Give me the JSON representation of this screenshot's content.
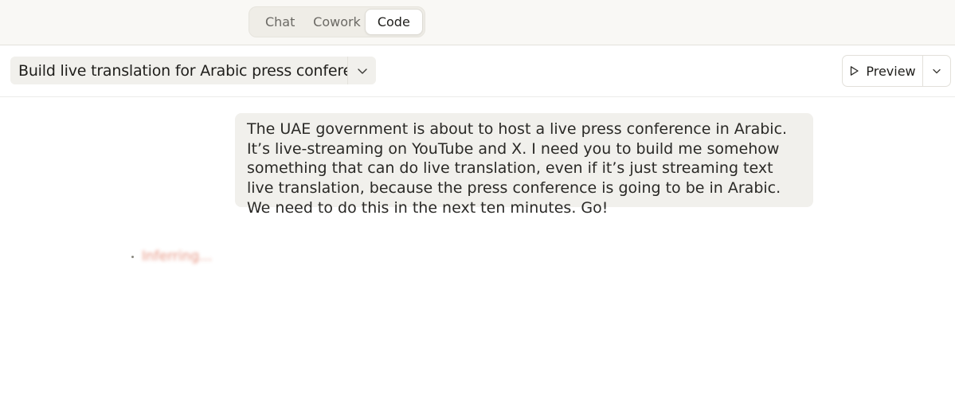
{
  "mode_switch": {
    "tabs": [
      {
        "label": "Chat",
        "selected": false
      },
      {
        "label": "Cowork",
        "selected": false
      },
      {
        "label": "Code",
        "selected": true
      }
    ]
  },
  "header": {
    "session_title": "Build live translation for Arabic press conference",
    "preview_label": "Preview"
  },
  "conversation": {
    "user_message": "The UAE government is about to host a live press conference in Arabic. It’s live-streaming on YouTube and X. I need you to build me somehow something that can do live translation, even if it’s just streaming text live translation, because the press conference is going to be in Arabic. We need to do this in the next ten minutes. Go!",
    "status_text": "Inferring..."
  },
  "colors": {
    "status_accent": "#e07a63",
    "bubble_background": "#f1f0ec",
    "topbar_background": "#f9f8f5"
  },
  "icons": {
    "title_dropdown": "chevron-down-icon",
    "preview": "play-icon",
    "preview_menu": "chevron-down-icon"
  }
}
